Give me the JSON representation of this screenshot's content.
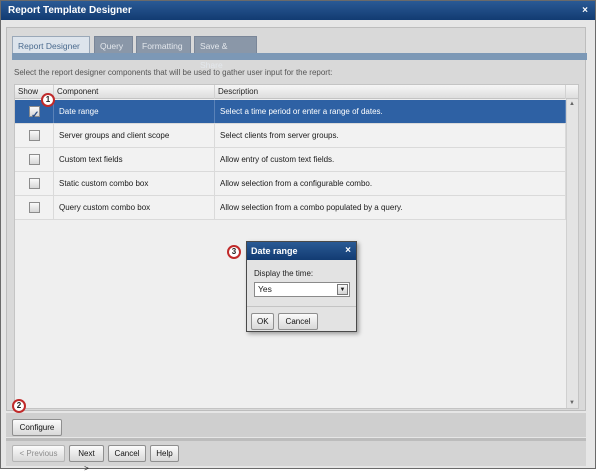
{
  "window": {
    "title": "Report Template Designer",
    "close_glyph": "×"
  },
  "tabs": [
    {
      "label": "Report Designer",
      "active": true
    },
    {
      "label": "Query",
      "active": false
    },
    {
      "label": "Formatting",
      "active": false
    },
    {
      "label": "Save & Share",
      "active": false
    }
  ],
  "instructions": "Select the report designer components that will be used to gather user input for the report:",
  "grid": {
    "columns": [
      "Show",
      "Component",
      "Description"
    ],
    "rows": [
      {
        "checked": true,
        "selected": true,
        "component": "Date range",
        "description": "Select a time period or enter a range of dates."
      },
      {
        "checked": false,
        "selected": false,
        "component": "Server groups and client scope",
        "description": "Select clients from server groups."
      },
      {
        "checked": false,
        "selected": false,
        "component": "Custom text fields",
        "description": "Allow entry of custom text fields."
      },
      {
        "checked": false,
        "selected": false,
        "component": "Static custom combo box",
        "description": "Allow selection from a configurable combo."
      },
      {
        "checked": false,
        "selected": false,
        "component": "Query custom combo box",
        "description": "Allow selection from a combo populated by a query."
      }
    ]
  },
  "callouts": [
    "1",
    "2",
    "3"
  ],
  "buttons": {
    "configure": "Configure",
    "previous": "< Previous",
    "next": "Next >",
    "cancel": "Cancel",
    "help": "Help"
  },
  "dialog": {
    "title": "Date range",
    "close_glyph": "×",
    "label": "Display the time:",
    "selected_value": "Yes",
    "ok": "OK",
    "cancel": "Cancel"
  },
  "colors": {
    "titlebar": "#1d4a85",
    "selected_row": "#2e61a4",
    "callout_ring": "#c02a2a",
    "tab_strip": "#7c98b6"
  }
}
